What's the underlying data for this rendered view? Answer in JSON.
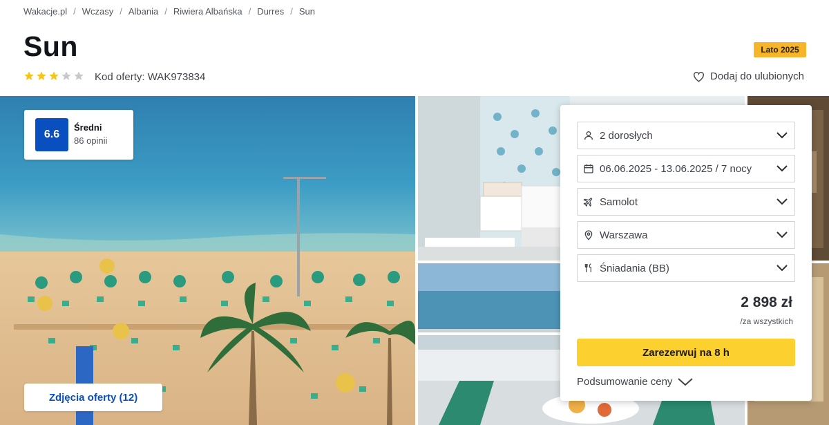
{
  "breadcrumb": [
    "Wakacje.pl",
    "Wczasy",
    "Albania",
    "Riwiera Albańska",
    "Durres",
    "Sun"
  ],
  "hotel": {
    "name": "Sun",
    "stars": 3,
    "max_stars": 5,
    "offer_code": "Kod oferty: WAK973834",
    "season_badge": "Lato 2025",
    "favorite_label": "Dodaj do ulubionych"
  },
  "rating": {
    "score": "6.6",
    "label": "Średni",
    "reviews": "86 opinii"
  },
  "gallery": {
    "photos_button": "Zdjęcia oferty (12)"
  },
  "booking": {
    "fields": [
      {
        "icon": "person-icon",
        "value": "2 dorosłych"
      },
      {
        "icon": "calendar-icon",
        "value": "06.06.2025 - 13.06.2025 / 7 nocy"
      },
      {
        "icon": "airplane-icon",
        "value": "Samolot"
      },
      {
        "icon": "location-pin-icon",
        "value": "Warszawa"
      },
      {
        "icon": "cutlery-icon",
        "value": "Śniadania (BB)"
      }
    ],
    "price": "2 898 zł",
    "price_note": "/za wszystkich",
    "reserve_label": "Zarezerwuj na 8 h",
    "summary_label": "Podsumowanie ceny"
  },
  "colors": {
    "accent_blue": "#0a4fc0",
    "cta_yellow": "#fcd02e",
    "badge_orange": "#f7b52c",
    "star_yellow": "#f5c518",
    "star_grey": "#c6c9ce"
  }
}
